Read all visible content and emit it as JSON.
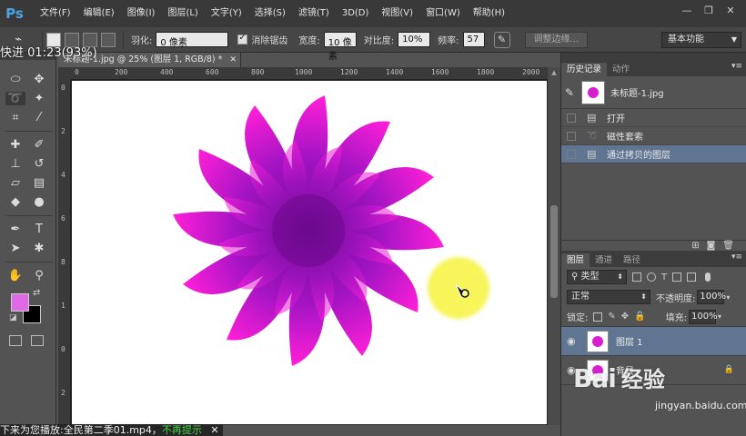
{
  "app": {
    "logo": "Ps",
    "menus": [
      "文件(F)",
      "编辑(E)",
      "图像(I)",
      "图层(L)",
      "文字(Y)",
      "选择(S)",
      "滤镜(T)",
      "3D(D)",
      "视图(V)",
      "窗口(W)",
      "帮助(H)"
    ],
    "window_controls": [
      "—",
      "❐",
      "✕"
    ]
  },
  "options_bar": {
    "feather_label": "羽化:",
    "feather_value": "0 像素",
    "antialias_label": "消除锯齿",
    "width_label": "宽度:",
    "width_value": "10 像素",
    "contrast_label": "对比度:",
    "contrast_value": "10%",
    "frequency_label": "频率:",
    "frequency_value": "57",
    "refine_edge_label": "调整边缘...",
    "workspace_value": "基本功能"
  },
  "video_overlay": {
    "top_text": "快进    01:23(93%)",
    "bottom_text": "下来为您播放:全民第二季01.mp4，",
    "bottom_link": "不再提示",
    "bottom_close": "✕"
  },
  "document": {
    "tab_title": "未标题-1.jpg @ 25% (图层 1, RGB/8) *",
    "tab_close": "✕",
    "ruler_h_labels": [
      "0",
      "200",
      "400",
      "600",
      "800",
      "1000",
      "1200",
      "1400",
      "1600",
      "1800",
      "2000"
    ],
    "ruler_v_labels": [
      "0",
      "2",
      "4",
      "6",
      "8",
      "1",
      "0",
      "2"
    ]
  },
  "colors": {
    "foreground": "#e06ae6",
    "background": "#000000",
    "flower_center": "#6b0a8c",
    "flower_edge": "#ff1fd8",
    "cursor_highlight": "#f7f55a",
    "selected_row": "#5f7591"
  },
  "history_panel": {
    "tabs": [
      "历史记录",
      "动作"
    ],
    "snapshot_label": "未标题-1.jpg",
    "items": [
      {
        "label": "打开",
        "icon": "document-icon",
        "selected": false
      },
      {
        "label": "磁性套索",
        "icon": "magnetic-lasso-icon",
        "selected": false
      },
      {
        "label": "通过拷贝的图层",
        "icon": "document-icon",
        "selected": true
      }
    ]
  },
  "layers_panel": {
    "tabs": [
      "图层",
      "通道",
      "路径"
    ],
    "filter_value": "类型",
    "blend_mode": "正常",
    "opacity_label": "不透明度:",
    "opacity_value": "100%",
    "lock_label": "锁定:",
    "fill_label": "填充:",
    "fill_value": "100%",
    "layers": [
      {
        "name": "图层 1",
        "selected": true,
        "locked": false
      },
      {
        "name": "背景",
        "selected": false,
        "locked": true
      }
    ]
  },
  "watermark": {
    "logo": "Bai",
    "logo_suffix": "经验",
    "url": "jingyan.baidu.com"
  }
}
